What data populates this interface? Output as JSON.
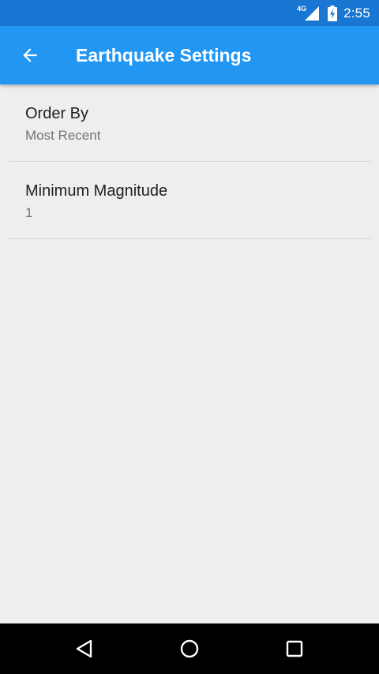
{
  "status_bar": {
    "network_label": "4G",
    "time": "2:55",
    "icons": [
      "signal-icon",
      "battery-charging-icon"
    ]
  },
  "app_bar": {
    "title": "Earthquake Settings",
    "back_icon": "arrow-back-icon",
    "background_color": "#2196f3",
    "status_color": "#1976d2"
  },
  "preferences": [
    {
      "title": "Order By",
      "summary": "Most Recent"
    },
    {
      "title": "Minimum Magnitude",
      "summary": "1"
    }
  ],
  "nav_bar": {
    "icons": [
      "nav-back-icon",
      "nav-home-icon",
      "nav-recents-icon"
    ]
  }
}
